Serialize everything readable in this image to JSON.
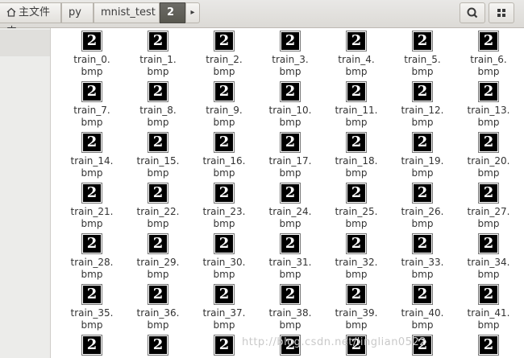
{
  "breadcrumb": {
    "home": "主文件夹",
    "items": [
      "py",
      "mnist_test",
      "2"
    ],
    "next_arrow": "▸"
  },
  "toolbar": {
    "search_icon": "search-icon",
    "view_icon": "grid-view-icon"
  },
  "files": [
    {
      "line1": "train_0.",
      "line2": "bmp",
      "glyph": "2"
    },
    {
      "line1": "train_1.",
      "line2": "bmp",
      "glyph": "2"
    },
    {
      "line1": "train_2.",
      "line2": "bmp",
      "glyph": "2"
    },
    {
      "line1": "train_3.",
      "line2": "bmp",
      "glyph": "2"
    },
    {
      "line1": "train_4.",
      "line2": "bmp",
      "glyph": "2"
    },
    {
      "line1": "train_5.",
      "line2": "bmp",
      "glyph": "2"
    },
    {
      "line1": "train_6.",
      "line2": "bmp",
      "glyph": "2"
    },
    {
      "line1": "train_7.",
      "line2": "bmp",
      "glyph": "2"
    },
    {
      "line1": "train_8.",
      "line2": "bmp",
      "glyph": "2"
    },
    {
      "line1": "train_9.",
      "line2": "bmp",
      "glyph": "2"
    },
    {
      "line1": "train_10.",
      "line2": "bmp",
      "glyph": "2"
    },
    {
      "line1": "train_11.",
      "line2": "bmp",
      "glyph": "2"
    },
    {
      "line1": "train_12.",
      "line2": "bmp",
      "glyph": "2"
    },
    {
      "line1": "train_13.",
      "line2": "bmp",
      "glyph": "2"
    },
    {
      "line1": "train_14.",
      "line2": "bmp",
      "glyph": "2"
    },
    {
      "line1": "train_15.",
      "line2": "bmp",
      "glyph": "2"
    },
    {
      "line1": "train_16.",
      "line2": "bmp",
      "glyph": "2"
    },
    {
      "line1": "train_17.",
      "line2": "bmp",
      "glyph": "2"
    },
    {
      "line1": "train_18.",
      "line2": "bmp",
      "glyph": "2"
    },
    {
      "line1": "train_19.",
      "line2": "bmp",
      "glyph": "2"
    },
    {
      "line1": "train_20.",
      "line2": "bmp",
      "glyph": "2"
    },
    {
      "line1": "train_21.",
      "line2": "bmp",
      "glyph": "2"
    },
    {
      "line1": "train_22.",
      "line2": "bmp",
      "glyph": "2"
    },
    {
      "line1": "train_23.",
      "line2": "bmp",
      "glyph": "2"
    },
    {
      "line1": "train_24.",
      "line2": "bmp",
      "glyph": "2"
    },
    {
      "line1": "train_25.",
      "line2": "bmp",
      "glyph": "2"
    },
    {
      "line1": "train_26.",
      "line2": "bmp",
      "glyph": "2"
    },
    {
      "line1": "train_27.",
      "line2": "bmp",
      "glyph": "2"
    },
    {
      "line1": "train_28.",
      "line2": "bmp",
      "glyph": "2"
    },
    {
      "line1": "train_29.",
      "line2": "bmp",
      "glyph": "2"
    },
    {
      "line1": "train_30.",
      "line2": "bmp",
      "glyph": "2"
    },
    {
      "line1": "train_31.",
      "line2": "bmp",
      "glyph": "2"
    },
    {
      "line1": "train_32.",
      "line2": "bmp",
      "glyph": "2"
    },
    {
      "line1": "train_33.",
      "line2": "bmp",
      "glyph": "2"
    },
    {
      "line1": "train_34.",
      "line2": "bmp",
      "glyph": "2"
    },
    {
      "line1": "train_35.",
      "line2": "bmp",
      "glyph": "2"
    },
    {
      "line1": "train_36.",
      "line2": "bmp",
      "glyph": "2"
    },
    {
      "line1": "train_37.",
      "line2": "bmp",
      "glyph": "2"
    },
    {
      "line1": "train_38.",
      "line2": "bmp",
      "glyph": "2"
    },
    {
      "line1": "train_39.",
      "line2": "bmp",
      "glyph": "2"
    },
    {
      "line1": "train_40.",
      "line2": "bmp",
      "glyph": "2"
    },
    {
      "line1": "train_41.",
      "line2": "bmp",
      "glyph": "2"
    },
    {
      "line1": "",
      "line2": "",
      "glyph": "2"
    },
    {
      "line1": "",
      "line2": "",
      "glyph": "2"
    },
    {
      "line1": "",
      "line2": "",
      "glyph": "2"
    },
    {
      "line1": "",
      "line2": "",
      "glyph": "2"
    },
    {
      "line1": "",
      "line2": "",
      "glyph": "2"
    },
    {
      "line1": "",
      "line2": "",
      "glyph": "2"
    },
    {
      "line1": "",
      "line2": "",
      "glyph": "2"
    }
  ],
  "watermark": "http://blog.csdn.net/linglian0522"
}
